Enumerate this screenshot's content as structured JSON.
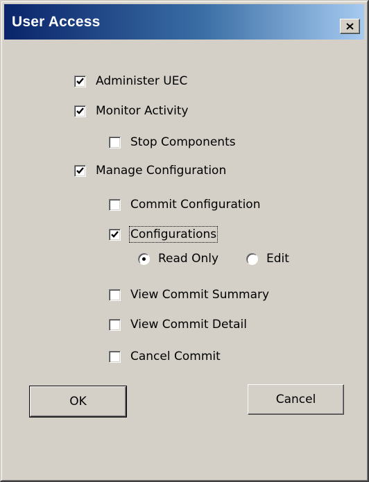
{
  "window": {
    "title": "User Access"
  },
  "options": {
    "administer_uec": {
      "label": "Administer UEC",
      "checked": true
    },
    "monitor_activity": {
      "label": "Monitor Activity",
      "checked": true
    },
    "stop_components": {
      "label": "Stop Components",
      "checked": false
    },
    "manage_configuration": {
      "label": "Manage Configuration",
      "checked": true
    },
    "commit_configuration": {
      "label": "Commit Configuration",
      "checked": false
    },
    "configurations": {
      "label": "Configurations",
      "checked": true
    },
    "read_only": {
      "label": "Read Only",
      "selected": true
    },
    "edit": {
      "label": "Edit",
      "selected": false
    },
    "view_commit_summary": {
      "label": "View Commit Summary",
      "checked": false
    },
    "view_commit_detail": {
      "label": "View Commit Detail",
      "checked": false
    },
    "cancel_commit": {
      "label": "Cancel Commit",
      "checked": false
    }
  },
  "buttons": {
    "ok": "OK",
    "cancel": "Cancel"
  },
  "icons": {
    "close": "close-icon",
    "check": "checkmark-icon",
    "radio": "radio-dot-icon"
  },
  "colors": {
    "title_start": "#0a246a",
    "title_end": "#a6caf0",
    "face": "#d4d0c8"
  }
}
